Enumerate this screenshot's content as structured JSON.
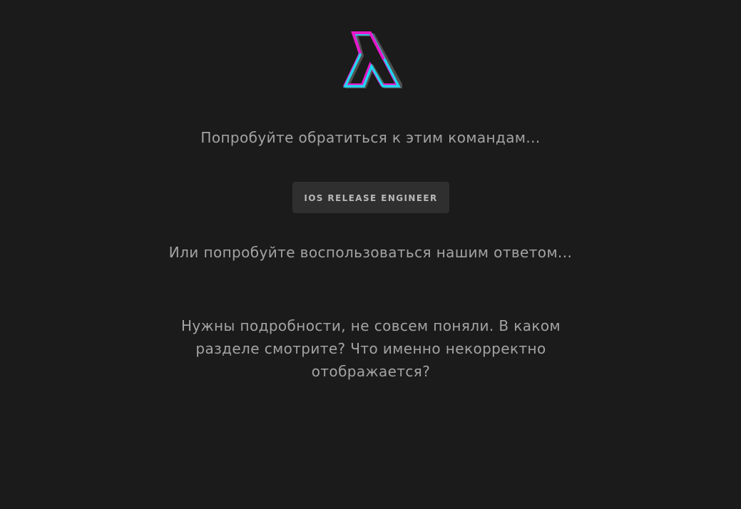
{
  "logo": {
    "icon": "lambda-logo-icon",
    "colors": {
      "magenta": "#e619c9",
      "cyan": "#1fd6ef",
      "shadow": "#5a5a5a"
    }
  },
  "teams_prompt": "Попробуйте обратиться к этим командам...",
  "team_buttons": [
    {
      "label": "IOS RELEASE ENGINEER"
    }
  ],
  "answer_prompt": "Или попробуйте воспользоваться нашим ответом...",
  "answer_text": "Нужны подробности, не совсем поняли. В каком разделе смотрите? Что именно некорректно отображается?"
}
